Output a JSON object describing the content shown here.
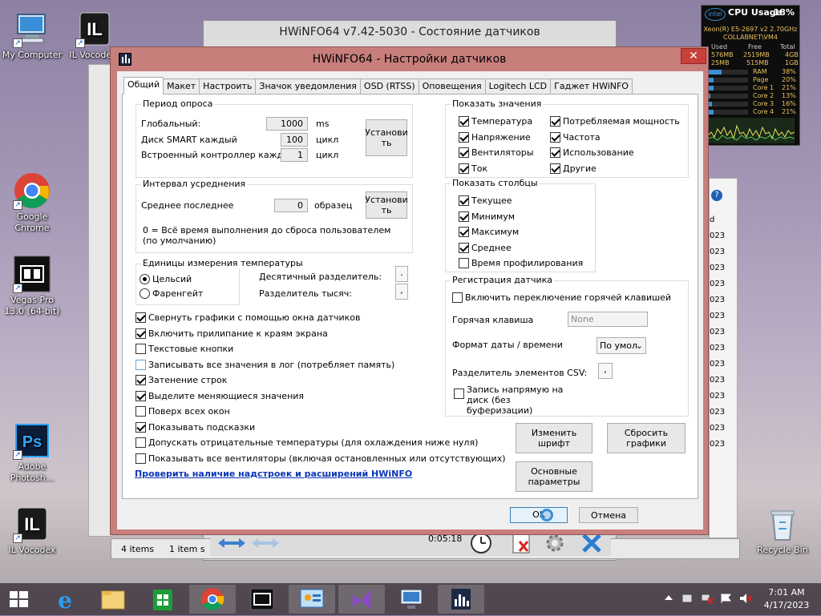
{
  "desktop": {
    "icons": [
      {
        "label": "My Computer",
        "name": "my-computer"
      },
      {
        "label": "IL Vocode...",
        "name": "il-vocoder-top"
      },
      {
        "label": "Google Chrome",
        "name": "google-chrome"
      },
      {
        "label": "Vegas Pro 13.0 (64-bit)",
        "name": "vegas-pro"
      },
      {
        "label": "Adobe Photosh...",
        "name": "adobe-photoshop"
      },
      {
        "label": "IL Vocodex",
        "name": "il-vocodex"
      },
      {
        "label": "Recycle Bin",
        "name": "recycle-bin"
      }
    ]
  },
  "background_window": {
    "title": "HWiNFO64 v7.42-5030 - Состояние датчиков",
    "status_items": "4 items",
    "status_selected": "1 item s",
    "timer": "0:05:18",
    "right_col": [
      "d",
      "023",
      "023",
      "023",
      "023",
      "023",
      "023",
      "023",
      "023",
      "023",
      "023",
      "023",
      "023",
      "023",
      "023"
    ]
  },
  "dialog": {
    "title": "HWiNFO64 - Настройки датчиков",
    "close": "✕",
    "tabs": [
      "Общий",
      "Макет",
      "Настроить",
      "Значок уведомления",
      "OSD (RTSS)",
      "Оповещения",
      "Logitech LCD",
      "Гаджет HWiNFO"
    ],
    "polling": {
      "group": "Период опроса",
      "global_label": "Глобальный:",
      "global_value": "1000",
      "global_unit": "ms",
      "smart_label": "Диск SMART каждый",
      "smart_value": "100",
      "smart_unit": "цикл",
      "ec_label": "Встроенный контроллер каждый",
      "ec_value": "1",
      "ec_unit": "цикл",
      "set_button": "Установи\nть"
    },
    "averaging": {
      "group": "Интервал усреднения",
      "last_label": "Среднее последнее",
      "last_value": "0",
      "last_unit": "образец",
      "set_button": "Установи\nть",
      "note": "0 = Всё время выполнения до сброса пользователем (по умолчанию)"
    },
    "temp_units": {
      "group": "Единицы измерения температуры",
      "celsius": "Цельсий",
      "fahrenheit": "Фаренгейт",
      "decimal_sep_label": "Десятичный разделитель:",
      "decimal_sep_value": ".",
      "thousand_sep_label": "Разделитель тысяч:",
      "thousand_sep_value": ","
    },
    "options": [
      {
        "label": "Свернуть графики с помощью окна датчиков",
        "checked": true
      },
      {
        "label": "Включить прилипание к краям экрана",
        "checked": true
      },
      {
        "label": "Текстовые кнопки",
        "checked": false
      },
      {
        "label": "Записывать все значения в лог (потребляет память)",
        "checked": false
      },
      {
        "label": "Затенение строк",
        "checked": true
      },
      {
        "label": "Выделите меняющиеся значения",
        "checked": true
      },
      {
        "label": "Поверх всех окон",
        "checked": false
      },
      {
        "label": "Показывать подсказки",
        "checked": true
      },
      {
        "label": "Допускать отрицательные температуры (для охлаждения ниже нуля)",
        "checked": false
      },
      {
        "label": "Показывать все вентиляторы (включая остановленных или отсутствующих)",
        "checked": false
      }
    ],
    "check_link": "Проверить наличие надстроек и расширений HWiNFO",
    "show_values": {
      "group": "Показать значения",
      "items": [
        {
          "label": "Температура",
          "checked": true
        },
        {
          "label": "Потребляемая мощность",
          "checked": true
        },
        {
          "label": "Напряжение",
          "checked": true
        },
        {
          "label": "Частота",
          "checked": true
        },
        {
          "label": "Вентиляторы",
          "checked": true
        },
        {
          "label": "Использование",
          "checked": true
        },
        {
          "label": "Ток",
          "checked": true
        },
        {
          "label": "Другие",
          "checked": true
        }
      ]
    },
    "show_columns": {
      "group": "Показать столбцы",
      "items": [
        {
          "label": "Текущее",
          "checked": true
        },
        {
          "label": "Минимум",
          "checked": true
        },
        {
          "label": "Максимум",
          "checked": true
        },
        {
          "label": "Среднее",
          "checked": true
        },
        {
          "label": "Время профилирования",
          "checked": false
        }
      ]
    },
    "logging": {
      "group": "Регистрация датчика",
      "hotkey_toggle": "Включить переключение горячей клавишей",
      "hotkey_label": "Горячая клавиша",
      "hotkey_value": "None",
      "datetime_label": "Формат даты / времени",
      "datetime_value": "По умол",
      "csv_label": "Разделитель элементов CSV:",
      "csv_value": ",",
      "direct_write": "Запись напрямую на диск (без буферизации)"
    },
    "buttons": {
      "change_font": "Изменить шрифт",
      "reset_graphs": "Сбросить графики",
      "main_params": "Основные параметры",
      "ok": "OK",
      "cancel": "Отмена"
    }
  },
  "gadget": {
    "title": "CPU Usage",
    "percent": "18%",
    "logo": "intel",
    "cpu_name": "Xeon(R) E5-2697 v2 2.70GHz",
    "machine": "COLLABNET\\VM4",
    "headers": [
      "Used",
      "Free",
      "Total"
    ],
    "row1": [
      "576MB",
      "2519MB",
      "4GB"
    ],
    "row2": [
      "25MB",
      "515MB",
      "1GB"
    ],
    "bars": [
      {
        "label": "RAM",
        "value": "38%",
        "fill": 0.38
      },
      {
        "label": "Page",
        "value": "20%",
        "fill": 0.2
      },
      {
        "label": "Core 1",
        "value": "21%",
        "fill": 0.21
      },
      {
        "label": "Core 2",
        "value": "13%",
        "fill": 0.13
      },
      {
        "label": "Core 3",
        "value": "16%",
        "fill": 0.16
      },
      {
        "label": "Core 4",
        "value": "21%",
        "fill": 0.21
      }
    ]
  },
  "taskbar": {
    "time": "7:01 AM",
    "date": "4/17/2023"
  },
  "colors": {
    "dialog_frame": "#c87f7c",
    "link": "#0a35b8",
    "taskbar": "#3c323c"
  }
}
